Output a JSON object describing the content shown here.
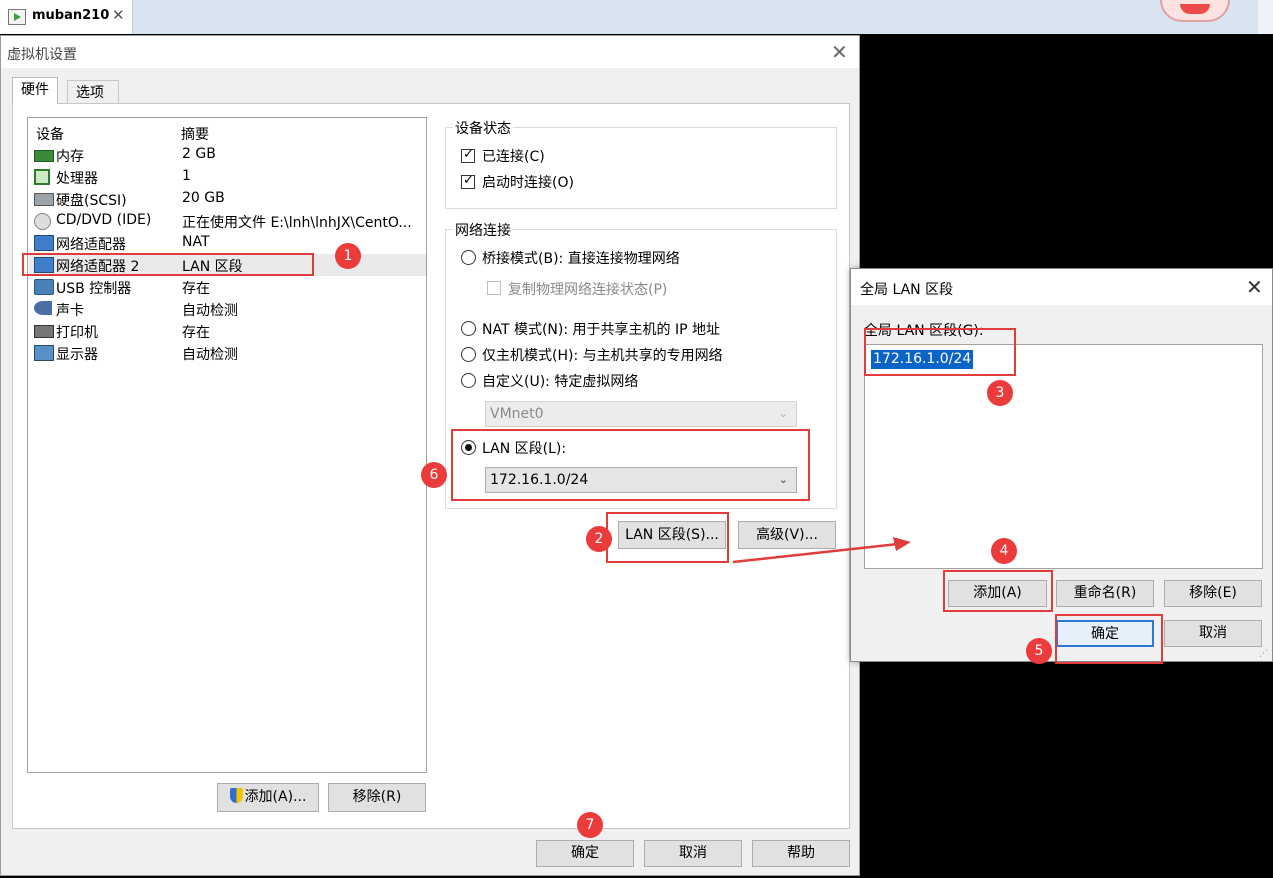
{
  "window": {
    "tab_title": "muban210",
    "tab_close": "✕"
  },
  "dialog": {
    "title": "虚拟机设置",
    "close": "✕",
    "tabs": {
      "hardware": "硬件",
      "options": "选项"
    },
    "device_table": {
      "headers": {
        "device": "设备",
        "summary": "摘要"
      },
      "rows": [
        {
          "name": "内存",
          "summary": "2 GB",
          "icon": "memory-icon"
        },
        {
          "name": "处理器",
          "summary": "1",
          "icon": "processor-icon"
        },
        {
          "name": "硬盘(SCSI)",
          "summary": "20 GB",
          "icon": "hard-disk-icon"
        },
        {
          "name": "CD/DVD (IDE)",
          "summary": "正在使用文件 E:\\lnh\\lnhJX\\CentO...",
          "icon": "cd-dvd-icon"
        },
        {
          "name": "网络适配器",
          "summary": "NAT",
          "icon": "network-adapter-icon"
        },
        {
          "name": "网络适配器 2",
          "summary": "LAN 区段",
          "icon": "network-adapter-icon"
        },
        {
          "name": "USB 控制器",
          "summary": "存在",
          "icon": "usb-icon"
        },
        {
          "name": "声卡",
          "summary": "自动检测",
          "icon": "sound-card-icon"
        },
        {
          "name": "打印机",
          "summary": "存在",
          "icon": "printer-icon"
        },
        {
          "name": "显示器",
          "summary": "自动检测",
          "icon": "monitor-icon"
        }
      ],
      "selected_index": 5
    },
    "add_button": "添加(A)...",
    "remove_button": "移除(R)",
    "device_status": {
      "label": "设备状态",
      "connected": "已连接(C)",
      "connect_at_power_on": "启动时连接(O)"
    },
    "network": {
      "label": "网络连接",
      "bridged": "桥接模式(B): 直接连接物理网络",
      "replicate": "复制物理网络连接状态(P)",
      "nat": "NAT 模式(N): 用于共享主机的 IP 地址",
      "host_only": "仅主机模式(H): 与主机共享的专用网络",
      "custom": "自定义(U): 特定虚拟网络",
      "custom_value": "VMnet0",
      "lan": "LAN 区段(L):",
      "lan_value": "172.16.1.0/24"
    },
    "lan_segments_button": "LAN 区段(S)...",
    "advanced_button": "高级(V)...",
    "ok": "确定",
    "cancel": "取消",
    "help": "帮助"
  },
  "lan_dialog": {
    "title": "全局 LAN 区段",
    "close": "✕",
    "list_label": "全局 LAN 区段(G):",
    "items": [
      "172.16.1.0/24"
    ],
    "add": "添加(A)",
    "rename": "重命名(R)",
    "remove": "移除(E)",
    "ok": "确定",
    "cancel": "取消"
  },
  "annotations": [
    "1",
    "2",
    "3",
    "4",
    "5",
    "6",
    "7"
  ],
  "colors": {
    "annotation_red": "#e03c3c",
    "selection_blue": "#0a64c8"
  }
}
